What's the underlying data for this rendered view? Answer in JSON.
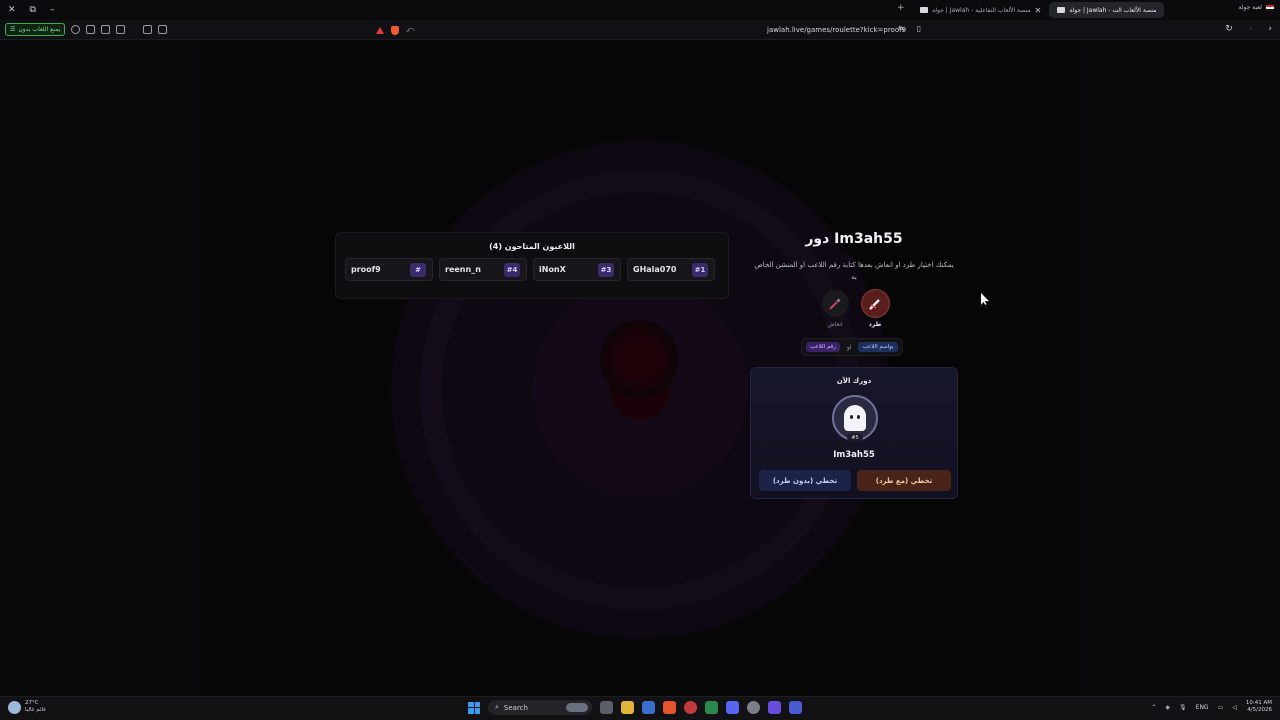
{
  "browser": {
    "tabs": [
      {
        "label": "جولة | Jawlah - منصة الألعاب التفاعلية",
        "active": false
      },
      {
        "label": "جولة | Jawlah - منصة الألعاب الت",
        "active": true
      }
    ],
    "right_tab_label": "لعبة جولة",
    "url": "jawlah.live/games/roulette?kick=proof9",
    "green_button_label": "يمنع اللعاب بدون"
  },
  "game": {
    "players_title": "اللاعبون المتاحون (4)",
    "players": [
      {
        "name": "proof9",
        "number": "#"
      },
      {
        "name": "reenn_n",
        "number": "#4"
      },
      {
        "name": "iNonX",
        "number": "#3"
      },
      {
        "name": "GHala070",
        "number": "#1"
      }
    ],
    "turn_title": "دور Im3ah55",
    "turn_subtitle": "يمكنك اختيار طرد او انعاش بعدها كتابة رقم اللاعب او المنشن الخاص به",
    "actions": [
      {
        "label": "انعاش",
        "icon": "syringe-icon",
        "active": false
      },
      {
        "label": "طرد",
        "icon": "kick-icon",
        "active": true
      }
    ],
    "input_modes": {
      "by_number": "رقم اللاعب",
      "or": "او",
      "by_mention": "بواسم اللاعب"
    },
    "current_card": {
      "title": "دورك الآن",
      "player_name": "Im3ah55",
      "player_number": "#5",
      "skip_without_kick": "تخطي (بدون طرد)",
      "skip_with_kick": "تخطي (مع طرد)"
    }
  },
  "taskbar": {
    "weather_temp": "27°C",
    "weather_desc": "غائم غالبا",
    "search_placeholder": "Search",
    "lang": "ENG",
    "time": "10:41 AM",
    "date": "4/5/2026"
  },
  "colors": {
    "accent_purple": "#3a2b6a",
    "kick": "#4a2418",
    "nokick": "#1c2348"
  }
}
